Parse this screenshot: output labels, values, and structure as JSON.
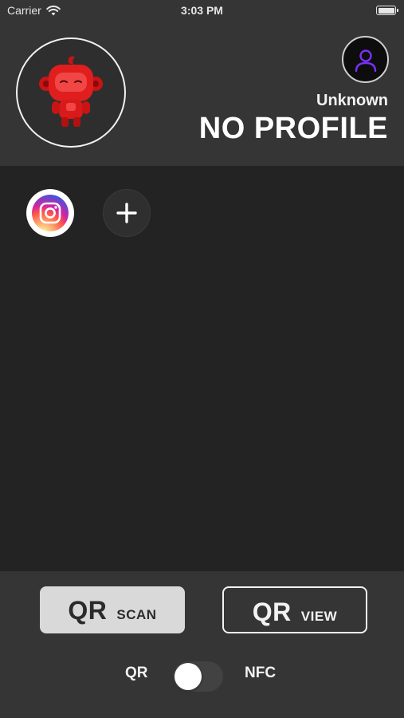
{
  "status_bar": {
    "carrier": "Carrier",
    "time": "3:03 PM",
    "wifi_icon": "wifi-icon",
    "battery_icon": "battery-icon",
    "battery_level": 1.0
  },
  "header": {
    "avatar_icon": "robot-mascot-icon",
    "account_icon": "person-icon",
    "profile_subtitle": "Unknown",
    "profile_title": "NO PROFILE"
  },
  "links": [
    {
      "icon": "instagram-icon"
    },
    {
      "icon": "plus-icon"
    }
  ],
  "actions": {
    "scan": {
      "main": "QR",
      "sub": "SCAN"
    },
    "view": {
      "main": "QR",
      "sub": "VIEW"
    }
  },
  "mode_toggle": {
    "left_label": "QR",
    "right_label": "NFC",
    "state": "off"
  },
  "colors": {
    "panel": "#353535",
    "background": "#232323",
    "scan_button": "#d9d9d9",
    "mascot_red": "#e01e1e",
    "account_accent": "#7b2ff7"
  }
}
